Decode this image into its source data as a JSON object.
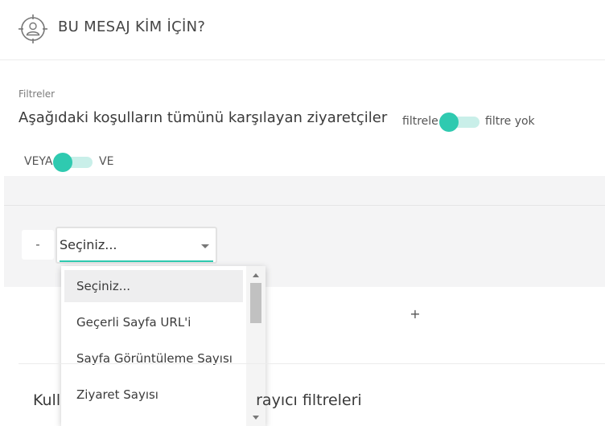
{
  "header": {
    "title": "BU MESAJ KİM İÇİN?",
    "icon": "target-user-icon"
  },
  "filters": {
    "caption": "Filtreler",
    "condition_text": "Aşağıdaki koşulların tümünü karşılayan ziyaretçiler",
    "filter_toggle": {
      "left_label": "filtrele",
      "right_label": "filtre yok",
      "state": "filtrele"
    },
    "logic_toggle": {
      "left_label": "VEYA",
      "right_label": "VE",
      "state": "VEYA"
    }
  },
  "rule": {
    "remove_label": "-",
    "select_value": "Seçiniz...",
    "add_label": "+"
  },
  "dropdown": {
    "options": [
      "Seçiniz...",
      "Geçerli Sayfa URL'i",
      "Sayfa Görüntüleme Sayısı",
      "Ziyaret Sayısı"
    ],
    "selected_index": 0
  },
  "section": {
    "title_left": "Kull",
    "title_right": "rayıcı filtreleri"
  },
  "colors": {
    "accent": "#2fcab0",
    "accent_light": "#c9efe9",
    "panel_bg": "#f4f4f5"
  }
}
